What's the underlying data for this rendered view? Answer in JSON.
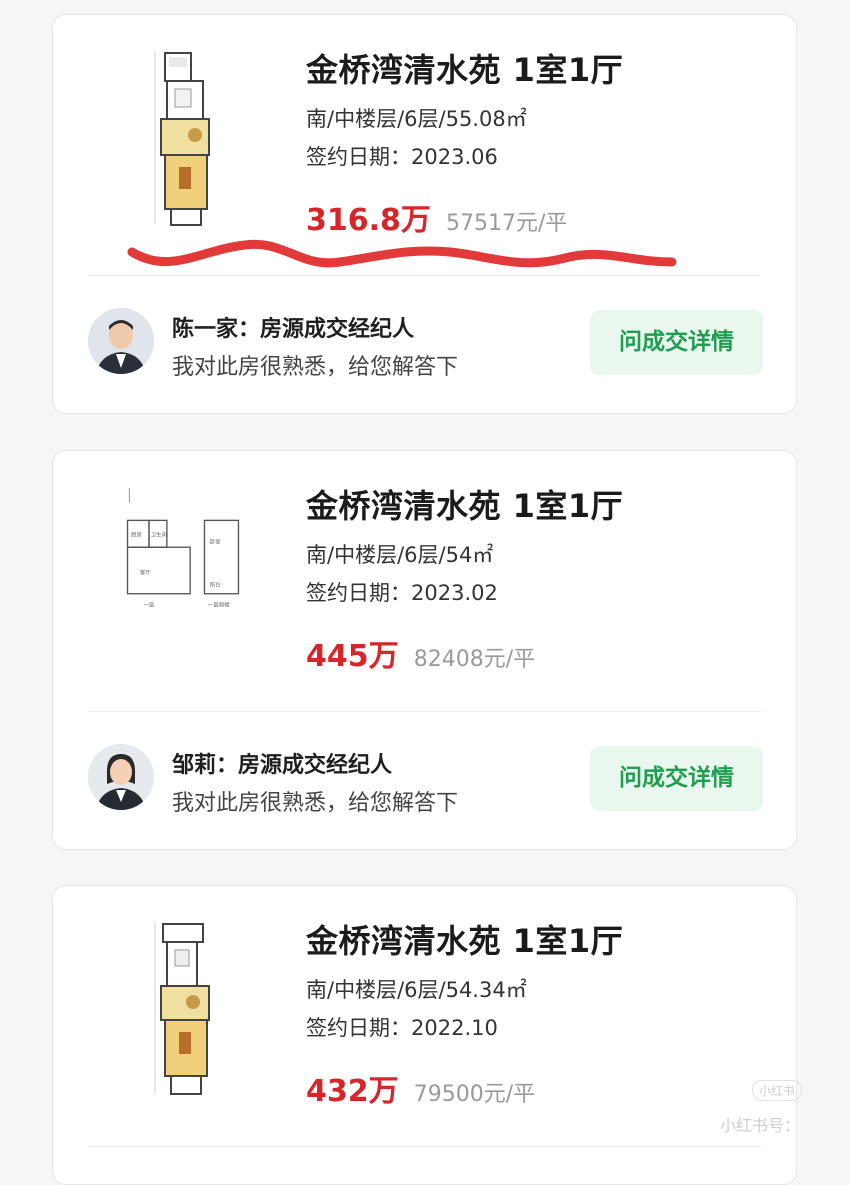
{
  "listings": [
    {
      "title": "金桥湾清水苑 1室1厅",
      "info": "南/中楼层/6层/55.08㎡",
      "date": "签约日期：2023.06",
      "price": "316.8万",
      "unit_price": "57517元/平",
      "agent": {
        "name": "陈一家：房源成交经纪人",
        "desc": "我对此房很熟悉，给您解答下",
        "button": "问成交详情"
      }
    },
    {
      "title": "金桥湾清水苑 1室1厅",
      "info": "南/中楼层/6层/54㎡",
      "date": "签约日期：2023.02",
      "price": "445万",
      "unit_price": "82408元/平",
      "plan_labels": [
        "厨房",
        "卫生间",
        "客厅",
        "卧室",
        "阳台",
        "一层",
        "一层阁楼"
      ],
      "agent": {
        "name": "邹莉：房源成交经纪人",
        "desc": "我对此房很熟悉，给您解答下",
        "button": "问成交详情"
      }
    },
    {
      "title": "金桥湾清水苑 1室1厅",
      "info": "南/中楼层/6层/54.34㎡",
      "date": "签约日期：2022.10",
      "price": "432万",
      "unit_price": "79500元/平"
    }
  ],
  "watermark": {
    "badge": "小红书",
    "text": "小红书号："
  },
  "colors": {
    "price": "#d7262a",
    "button_text": "#1f9e52",
    "button_bg": "#e9f7ee",
    "scribble": "#e23a3a"
  }
}
